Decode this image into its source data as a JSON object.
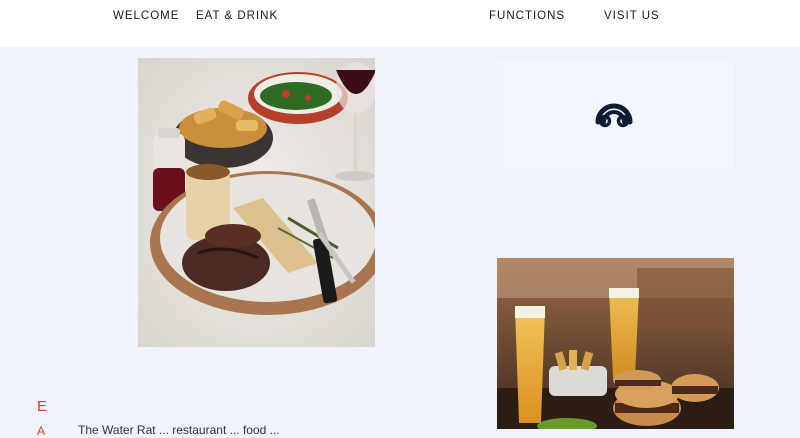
{
  "nav": {
    "items": [
      {
        "label": "WELCOME"
      },
      {
        "label": "EAT & DRINK"
      },
      {
        "label": "FUNCTIONS"
      },
      {
        "label": "VISIT US"
      }
    ]
  },
  "intro": {
    "heading_letter": "E",
    "mark": "A",
    "text": "The Water Rat ... restaurant ... food ..."
  },
  "colors": {
    "background": "#eff3fc",
    "nav_bg": "#ffffff",
    "accent": "#d6411f",
    "logo": "#0d1b33"
  },
  "icons": {
    "logo": "water-rat-logo-icon"
  }
}
